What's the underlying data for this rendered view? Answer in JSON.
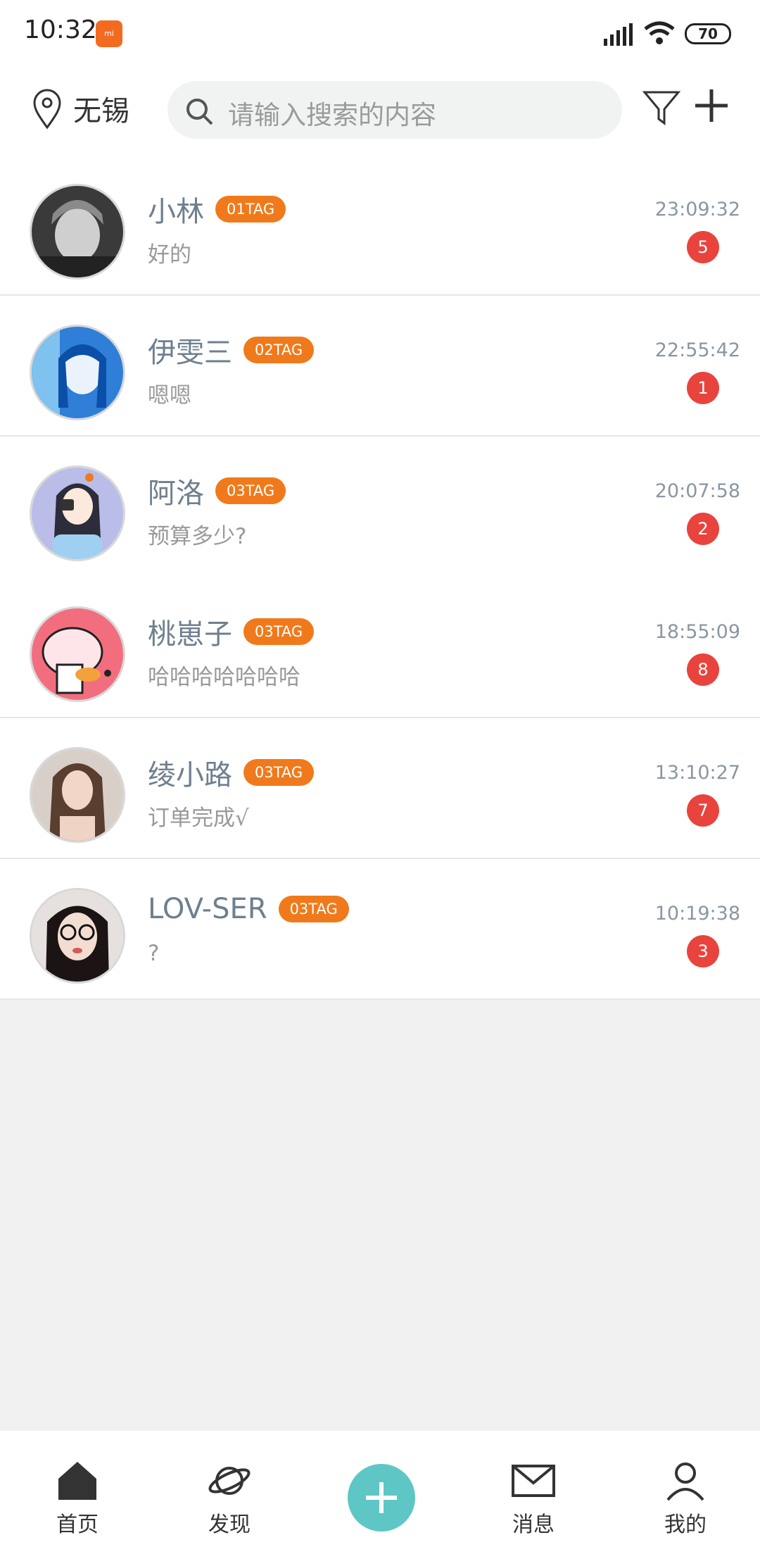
{
  "status_bar": {
    "time": "10:32",
    "battery": "70"
  },
  "header": {
    "city": "无锡",
    "search_placeholder": "请输入搜索的内容"
  },
  "chats": [
    {
      "name": "小林",
      "tag": "01TAG",
      "preview": "好的",
      "time": "23:09:32",
      "unread": "5"
    },
    {
      "name": "伊雯三",
      "tag": "02TAG",
      "preview": "嗯嗯",
      "time": "22:55:42",
      "unread": "1"
    },
    {
      "name": "阿洛",
      "tag": "03TAG",
      "preview": "预算多少?",
      "time": "20:07:58",
      "unread": "2"
    },
    {
      "name": "桃崽子",
      "tag": "03TAG",
      "preview": "哈哈哈哈哈哈哈",
      "time": "18:55:09",
      "unread": "8"
    },
    {
      "name": "绫小路",
      "tag": "03TAG",
      "preview": "订单完成√",
      "time": "13:10:27",
      "unread": "7"
    },
    {
      "name": "LOV-SER",
      "tag": "03TAG",
      "preview": "?",
      "time": "10:19:38",
      "unread": "3"
    }
  ],
  "nav": {
    "home": "首页",
    "discover": "发现",
    "messages": "消息",
    "mine": "我的"
  },
  "colors": {
    "tag": "#f07a1b",
    "badge": "#e8443d",
    "accent": "#5fc6c6"
  }
}
